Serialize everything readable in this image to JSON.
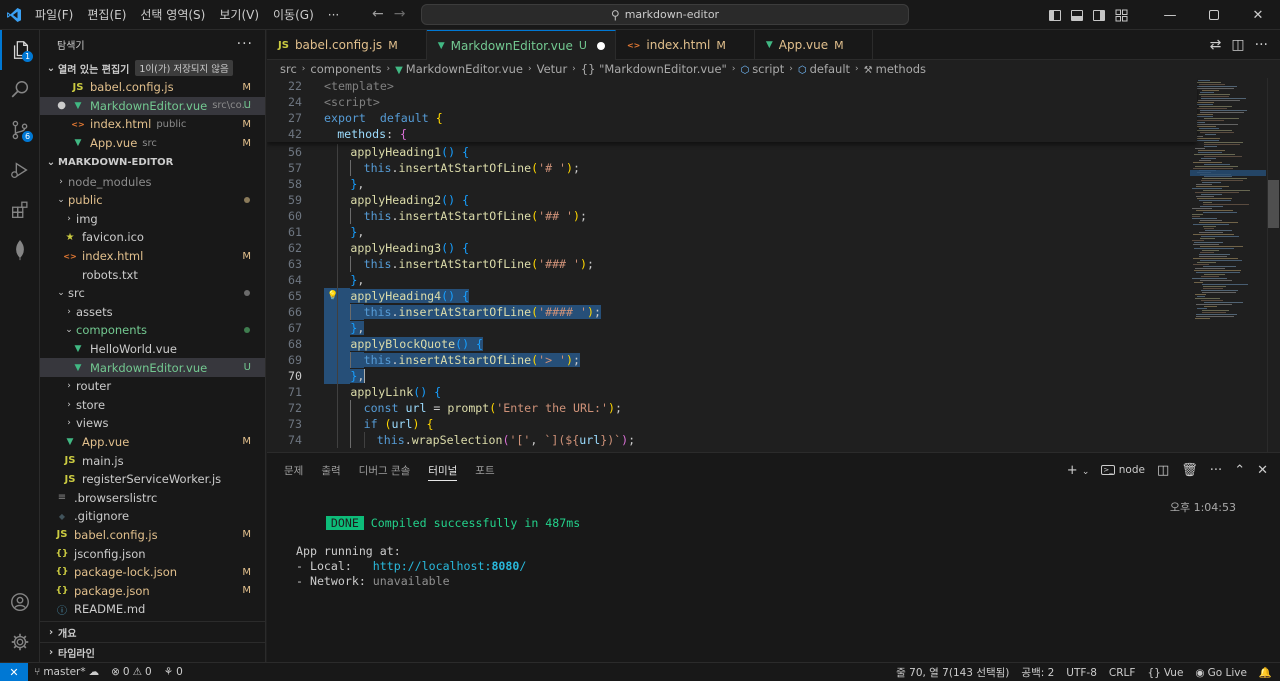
{
  "titlebar": {
    "menus": [
      "파일(F)",
      "편집(E)",
      "선택 영역(S)",
      "보기(V)",
      "이동(G)",
      "···"
    ],
    "search": "markdown-editor"
  },
  "activity": {
    "explorer_badge": "1",
    "scm_badge": "6"
  },
  "sidebar": {
    "title": "탐색기",
    "open_editors": {
      "title": "열려 있는 편집기",
      "unsaved": "1이(가) 저장되지 않음",
      "items": [
        {
          "name": "babel.config.js",
          "desc": "",
          "status": "M",
          "icon": "js"
        },
        {
          "name": "MarkdownEditor.vue",
          "desc": "src\\co...",
          "status": "U",
          "icon": "vue"
        },
        {
          "name": "index.html",
          "desc": "public",
          "status": "M",
          "icon": "html"
        },
        {
          "name": "App.vue",
          "desc": "src",
          "status": "M",
          "icon": "vue"
        }
      ]
    },
    "project": {
      "title": "MARKDOWN-EDITOR",
      "tree": [
        {
          "name": "node_modules",
          "depth": 0,
          "type": "folder",
          "open": false,
          "color": "dim"
        },
        {
          "name": "public",
          "depth": 0,
          "type": "folder",
          "open": true,
          "color": "mod",
          "dot": "#8a7a5a"
        },
        {
          "name": "img",
          "depth": 1,
          "type": "folder",
          "open": false
        },
        {
          "name": "favicon.ico",
          "depth": 1,
          "type": "star"
        },
        {
          "name": "index.html",
          "depth": 1,
          "type": "html",
          "status": "M",
          "color": "mod"
        },
        {
          "name": "robots.txt",
          "depth": 1,
          "type": "txt"
        },
        {
          "name": "src",
          "depth": 0,
          "type": "folder",
          "open": true,
          "dot": "#6b6b6b"
        },
        {
          "name": "assets",
          "depth": 1,
          "type": "folder",
          "open": false
        },
        {
          "name": "components",
          "depth": 1,
          "type": "folder",
          "open": true,
          "color": "unt",
          "dot": "#3f7d4f"
        },
        {
          "name": "HelloWorld.vue",
          "depth": 2,
          "type": "vue"
        },
        {
          "name": "MarkdownEditor.vue",
          "depth": 2,
          "type": "vue",
          "status": "U",
          "color": "unt",
          "selected": true
        },
        {
          "name": "router",
          "depth": 1,
          "type": "folder",
          "open": false
        },
        {
          "name": "store",
          "depth": 1,
          "type": "folder",
          "open": false
        },
        {
          "name": "views",
          "depth": 1,
          "type": "folder",
          "open": false
        },
        {
          "name": "App.vue",
          "depth": 1,
          "type": "vue",
          "status": "M",
          "color": "mod"
        },
        {
          "name": "main.js",
          "depth": 1,
          "type": "js"
        },
        {
          "name": "registerServiceWorker.js",
          "depth": 1,
          "type": "js"
        },
        {
          "name": ".browserslistrc",
          "depth": 0,
          "type": "dot"
        },
        {
          "name": ".gitignore",
          "depth": 0,
          "type": "git"
        },
        {
          "name": "babel.config.js",
          "depth": 0,
          "type": "js",
          "status": "M",
          "color": "mod"
        },
        {
          "name": "jsconfig.json",
          "depth": 0,
          "type": "json"
        },
        {
          "name": "package-lock.json",
          "depth": 0,
          "type": "json",
          "status": "M",
          "color": "mod"
        },
        {
          "name": "package.json",
          "depth": 0,
          "type": "json",
          "status": "M",
          "color": "mod"
        },
        {
          "name": "README.md",
          "depth": 0,
          "type": "info"
        }
      ]
    },
    "outline": "개요",
    "timeline": "타임라인"
  },
  "tabs": [
    {
      "name": "babel.config.js",
      "mark": "M",
      "icon": "js"
    },
    {
      "name": "MarkdownEditor.vue",
      "mark": "U",
      "icon": "vue",
      "active": true,
      "dirty": true
    },
    {
      "name": "index.html",
      "mark": "M",
      "icon": "html"
    },
    {
      "name": "App.vue",
      "mark": "M",
      "icon": "vue"
    }
  ],
  "breadcrumb": [
    "src",
    "components",
    "MarkdownEditor.vue",
    "Vetur",
    "{} \"MarkdownEditor.vue\"",
    "script",
    "default",
    "methods"
  ],
  "editor": {
    "sticky": [
      {
        "n": "22",
        "i": 0,
        "t": [
          [
            "tag",
            "<template>"
          ]
        ]
      },
      {
        "n": "24",
        "i": 0,
        "t": [
          [
            "tag",
            "<script>"
          ]
        ]
      },
      {
        "n": "27",
        "i": 0,
        "t": [
          [
            "kw",
            "export"
          ],
          [
            "",
            "  "
          ],
          [
            "kw",
            "default"
          ],
          [
            "",
            " "
          ],
          [
            "br1",
            "{"
          ]
        ]
      },
      {
        "n": "42",
        "i": 1,
        "t": [
          [
            "vr",
            "methods"
          ],
          [
            "",
            ": "
          ],
          [
            "br2",
            "{"
          ]
        ]
      }
    ],
    "lines": [
      {
        "n": "56",
        "i": 2,
        "t": [
          [
            "fn",
            "applyHeading1"
          ],
          [
            "br3",
            "()"
          ],
          [
            "",
            " "
          ],
          [
            "br3",
            "{"
          ]
        ]
      },
      {
        "n": "57",
        "i": 3,
        "t": [
          [
            "kw",
            "this"
          ],
          [
            "",
            "."
          ],
          [
            "fn",
            "insertAtStartOfLine"
          ],
          [
            "br1",
            "("
          ],
          [
            "str",
            "'# '"
          ],
          [
            "br1",
            ")"
          ],
          [
            "",
            ";"
          ]
        ]
      },
      {
        "n": "58",
        "i": 2,
        "t": [
          [
            "br3",
            "}"
          ],
          [
            "",
            ","
          ]
        ]
      },
      {
        "n": "59",
        "i": 2,
        "t": [
          [
            "fn",
            "applyHeading2"
          ],
          [
            "br3",
            "()"
          ],
          [
            "",
            " "
          ],
          [
            "br3",
            "{"
          ]
        ]
      },
      {
        "n": "60",
        "i": 3,
        "t": [
          [
            "kw",
            "this"
          ],
          [
            "",
            "."
          ],
          [
            "fn",
            "insertAtStartOfLine"
          ],
          [
            "br1",
            "("
          ],
          [
            "str",
            "'## '"
          ],
          [
            "br1",
            ")"
          ],
          [
            "",
            ";"
          ]
        ]
      },
      {
        "n": "61",
        "i": 2,
        "t": [
          [
            "br3",
            "}"
          ],
          [
            "",
            ","
          ]
        ]
      },
      {
        "n": "62",
        "i": 2,
        "t": [
          [
            "fn",
            "applyHeading3"
          ],
          [
            "br3",
            "()"
          ],
          [
            "",
            " "
          ],
          [
            "br3",
            "{"
          ]
        ]
      },
      {
        "n": "63",
        "i": 3,
        "t": [
          [
            "kw",
            "this"
          ],
          [
            "",
            "."
          ],
          [
            "fn",
            "insertAtStartOfLine"
          ],
          [
            "br1",
            "("
          ],
          [
            "str",
            "'### '"
          ],
          [
            "br1",
            ")"
          ],
          [
            "",
            ";"
          ]
        ]
      },
      {
        "n": "64",
        "i": 2,
        "t": [
          [
            "br3",
            "}"
          ],
          [
            "",
            ","
          ]
        ]
      },
      {
        "n": "65",
        "i": 2,
        "sel": true,
        "bulb": true,
        "t": [
          [
            "fn",
            "applyHeading4"
          ],
          [
            "br3",
            "()"
          ],
          [
            "",
            " "
          ],
          [
            "br3",
            "{"
          ]
        ]
      },
      {
        "n": "66",
        "i": 3,
        "sel": true,
        "t": [
          [
            "kw",
            "this"
          ],
          [
            "",
            "."
          ],
          [
            "fn",
            "insertAtStartOfLine"
          ],
          [
            "br1",
            "("
          ],
          [
            "str",
            "'#### '"
          ],
          [
            "br1",
            ")"
          ],
          [
            "",
            ";"
          ]
        ]
      },
      {
        "n": "67",
        "i": 2,
        "sel": true,
        "t": [
          [
            "br3",
            "}"
          ],
          [
            "",
            ","
          ]
        ]
      },
      {
        "n": "68",
        "i": 2,
        "sel": true,
        "t": [
          [
            "fn",
            "applyBlockQuote"
          ],
          [
            "br3",
            "()"
          ],
          [
            "",
            " "
          ],
          [
            "br3",
            "{"
          ]
        ]
      },
      {
        "n": "69",
        "i": 3,
        "sel": true,
        "t": [
          [
            "kw",
            "this"
          ],
          [
            "",
            "."
          ],
          [
            "fn",
            "insertAtStartOfLine"
          ],
          [
            "br1",
            "("
          ],
          [
            "str",
            "'> '"
          ],
          [
            "br1",
            ")"
          ],
          [
            "",
            ";"
          ]
        ]
      },
      {
        "n": "70",
        "i": 2,
        "sel": true,
        "cur": true,
        "t": [
          [
            "br3",
            "}"
          ],
          [
            "",
            ","
          ]
        ]
      },
      {
        "n": "71",
        "i": 2,
        "t": [
          [
            "fn",
            "applyLink"
          ],
          [
            "br3",
            "()"
          ],
          [
            "",
            " "
          ],
          [
            "br3",
            "{"
          ]
        ]
      },
      {
        "n": "72",
        "i": 3,
        "t": [
          [
            "kw",
            "const"
          ],
          [
            "",
            " "
          ],
          [
            "vr",
            "url"
          ],
          [
            "",
            " = "
          ],
          [
            "fn",
            "prompt"
          ],
          [
            "br1",
            "("
          ],
          [
            "str",
            "'Enter the URL:'"
          ],
          [
            "br1",
            ")"
          ],
          [
            "",
            ";"
          ]
        ]
      },
      {
        "n": "73",
        "i": 3,
        "t": [
          [
            "kw",
            "if"
          ],
          [
            "",
            " "
          ],
          [
            "br1",
            "("
          ],
          [
            "vr",
            "url"
          ],
          [
            "br1",
            ")"
          ],
          [
            "",
            " "
          ],
          [
            "br1",
            "{"
          ]
        ]
      },
      {
        "n": "74",
        "i": 4,
        "t": [
          [
            "kw",
            "this"
          ],
          [
            "",
            "."
          ],
          [
            "fn",
            "wrapSelection"
          ],
          [
            "br2",
            "("
          ],
          [
            "str",
            "'['"
          ],
          [
            "",
            ", "
          ],
          [
            "str",
            "`](${"
          ],
          [
            "vr",
            "url"
          ],
          [
            "str",
            "})`"
          ],
          [
            "br2",
            ")"
          ],
          [
            "",
            ";"
          ]
        ]
      }
    ]
  },
  "panel": {
    "tabs": [
      "문제",
      "출력",
      "디버그 콘솔",
      "터미널",
      "포트"
    ],
    "active_tab": 3,
    "node_label": "node",
    "time": "오후 1:04:53",
    "done": "DONE",
    "compiled": "Compiled successfully in 487ms",
    "running": "App running at:",
    "local_label": "- Local:   ",
    "local_url": "http://localhost:",
    "local_port": "8080",
    "local_slash": "/",
    "network_label": "- Network: ",
    "network_value": "unavailable"
  },
  "statusbar": {
    "branch": "master*",
    "errors": "0",
    "warnings": "0",
    "ports": "0",
    "position": "줄 70, 열 7(143 선택됨)",
    "spaces": "공백: 2",
    "encoding": "UTF-8",
    "eol": "CRLF",
    "language": "Vue",
    "golive": "Go Live"
  }
}
